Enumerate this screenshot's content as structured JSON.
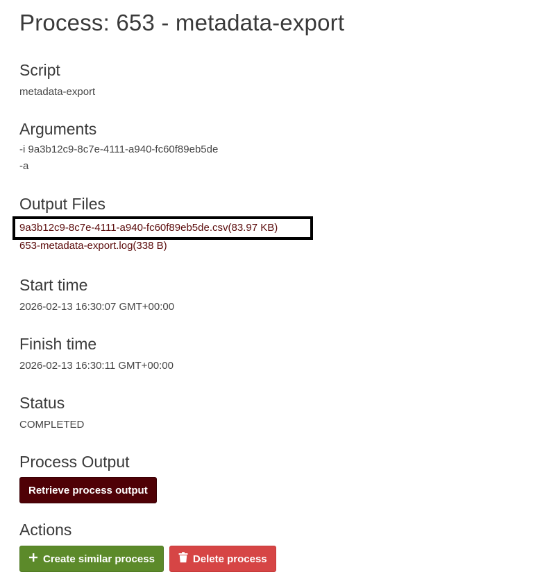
{
  "page": {
    "title": "Process: 653 - metadata-export"
  },
  "script": {
    "heading": "Script",
    "value": "metadata-export"
  },
  "arguments": {
    "heading": "Arguments",
    "lines": [
      "-i 9a3b12c9-8c7e-4111-a940-fc60f89eb5de",
      "-a"
    ]
  },
  "output_files": {
    "heading": "Output Files",
    "files": [
      "9a3b12c9-8c7e-4111-a940-fc60f89eb5de.csv(83.97 KB)",
      "653-metadata-export.log(338 B)"
    ]
  },
  "start_time": {
    "heading": "Start time",
    "value": "2026-02-13 16:30:07 GMT+00:00"
  },
  "finish_time": {
    "heading": "Finish time",
    "value": "2026-02-13 16:30:11 GMT+00:00"
  },
  "status": {
    "heading": "Status",
    "value": "COMPLETED"
  },
  "process_output": {
    "heading": "Process Output",
    "retrieve_label": "Retrieve process output"
  },
  "actions": {
    "heading": "Actions",
    "create_label": "Create similar process",
    "delete_label": "Delete process",
    "create_icon": "plus-icon",
    "delete_icon": "trash-icon"
  },
  "colors": {
    "primary": "#4f0106",
    "success": "#5c8a2a",
    "danger": "#d64545",
    "link": "#5a0a0a"
  }
}
